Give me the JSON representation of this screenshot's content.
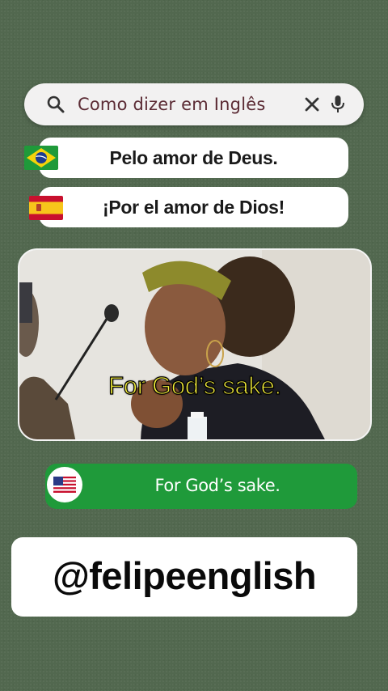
{
  "search": {
    "query": "Como dizer em Inglês",
    "icon_left": "search-icon",
    "icon_clear": "close-icon",
    "icon_voice": "microphone-icon"
  },
  "translations": [
    {
      "language_flag": "brazil-flag-icon",
      "text": "Pelo amor de Deus."
    },
    {
      "language_flag": "spain-flag-icon",
      "text": "¡Por el amor de Dios!"
    }
  ],
  "video": {
    "caption": "For God’s sake.",
    "caption_color": "#f5ef3a"
  },
  "english": {
    "language_flag": "usa-flag-icon",
    "text": "For God’s sake.",
    "bar_color": "#1f9a3a"
  },
  "handle": {
    "text": "@felipeenglish"
  },
  "colors": {
    "background": "#52684f",
    "search_text": "#5b2b34"
  }
}
